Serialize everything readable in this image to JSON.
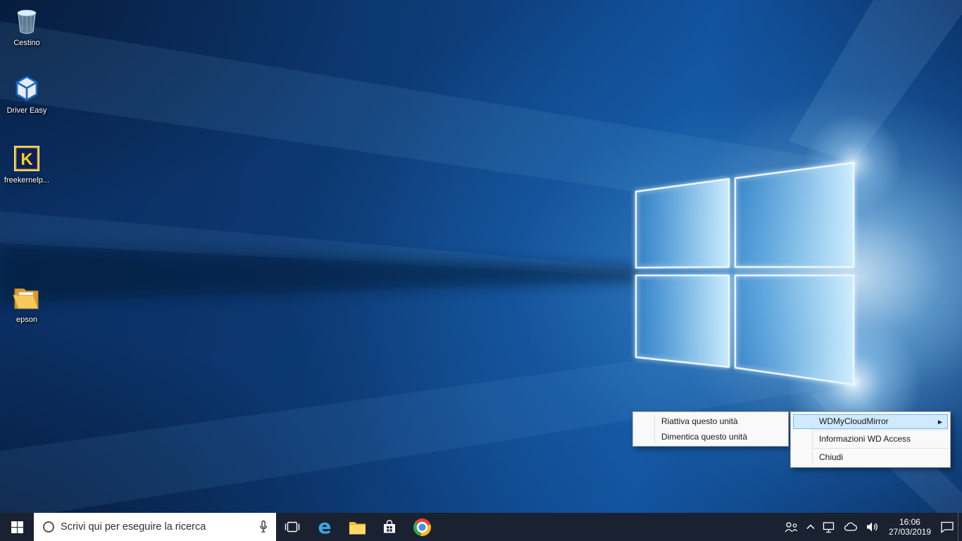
{
  "desktop": {
    "icons": [
      {
        "label": "Cestino"
      },
      {
        "label": "Driver Easy"
      },
      {
        "label": "freekernelp..."
      },
      {
        "label": "epson"
      }
    ]
  },
  "tray_menu": {
    "submenu": {
      "items": [
        {
          "label": "Riattiva questo unità"
        },
        {
          "label": "Dimentica questo unità"
        }
      ]
    },
    "main": {
      "items": [
        {
          "label": "WDMyCloudMirror"
        },
        {
          "label": "Informazioni WD Access"
        },
        {
          "label": "Chiudi"
        }
      ],
      "selected_index": 0
    }
  },
  "taskbar": {
    "search_placeholder": "Scrivi qui per eseguire la ricerca",
    "clock": {
      "time": "16:06",
      "date": "27/03/2019"
    }
  },
  "icons": {
    "submenu_arrow": "▶",
    "edge_glyph": "e",
    "kernel_k": "K"
  },
  "colors": {
    "taskbar_bg": "#1a2130",
    "menu_selection_fill": "#cfe9ff",
    "menu_selection_border": "#7ab8e8",
    "wallpaper_base": "#0d3a74"
  }
}
